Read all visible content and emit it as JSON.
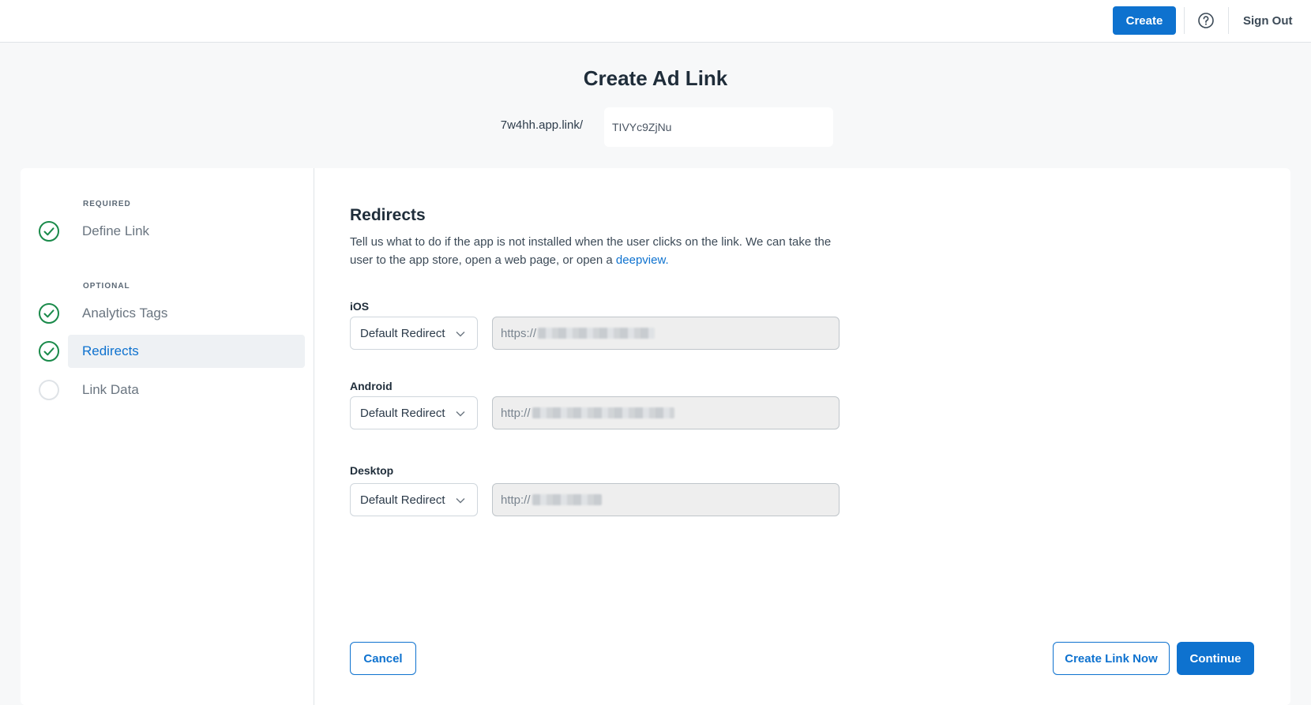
{
  "topbar": {
    "create_label": "Create",
    "help_icon": "question-circle-icon",
    "signout_label": "Sign Out"
  },
  "page": {
    "title": "Create Ad Link",
    "domain": "7w4hh.app.link/",
    "alias_value": "TIVYc9ZjNu"
  },
  "sidebar": {
    "required_label": "REQUIRED",
    "optional_label": "OPTIONAL",
    "steps": [
      {
        "label": "Define Link",
        "status": "complete"
      },
      {
        "label": "Analytics Tags",
        "status": "complete"
      },
      {
        "label": "Redirects",
        "status": "active"
      },
      {
        "label": "Link Data",
        "status": "incomplete"
      }
    ]
  },
  "redirects": {
    "title": "Redirects",
    "description": "Tell us what to do if the app is not installed when the user clicks on the link. We can take the user to the app store, open a web page, or open a ",
    "description_link": "deepview.",
    "platforms": [
      {
        "label": "iOS",
        "selection": "Default Redirect",
        "url_prefix": "https://"
      },
      {
        "label": "Android",
        "selection": "Default Redirect",
        "url_prefix": "http://"
      },
      {
        "label": "Desktop",
        "selection": "Default Redirect",
        "url_prefix": "http://"
      }
    ]
  },
  "footer": {
    "cancel_label": "Cancel",
    "create_now_label": "Create Link Now",
    "continue_label": "Continue"
  },
  "colors": {
    "primary": "#0e72cf",
    "success": "#1a8a4a"
  }
}
